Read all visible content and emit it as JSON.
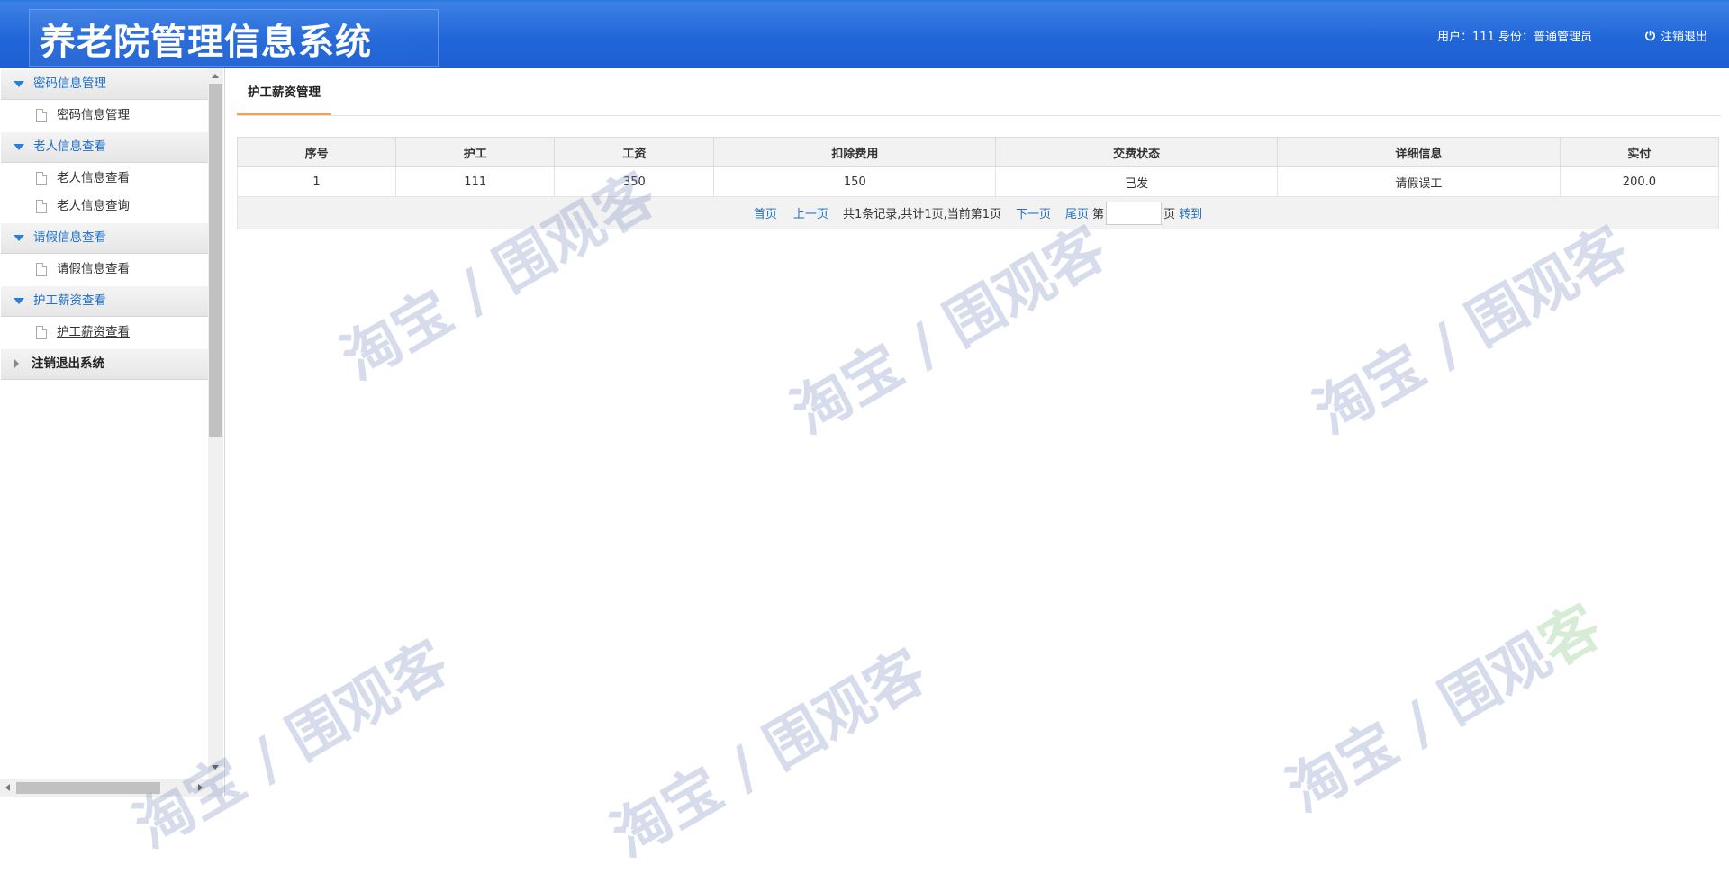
{
  "header": {
    "title": "养老院管理信息系统",
    "user_info": "用户：111 身份：普通管理员",
    "logout_label": "注销退出"
  },
  "sidebar": {
    "groups": [
      {
        "label": "密码信息管理",
        "items": [
          {
            "label": "密码信息管理"
          }
        ]
      },
      {
        "label": "老人信息查看",
        "items": [
          {
            "label": "老人信息查看"
          },
          {
            "label": "老人信息查询"
          }
        ]
      },
      {
        "label": "请假信息查看",
        "items": [
          {
            "label": "请假信息查看"
          }
        ]
      },
      {
        "label": "护工薪资查看",
        "items": [
          {
            "label": "护工薪资查看"
          }
        ]
      }
    ],
    "logout_group": "注销退出系统"
  },
  "main": {
    "tab": "护工薪资管理",
    "table": {
      "headers": [
        "序号",
        "护工",
        "工资",
        "扣除费用",
        "交费状态",
        "详细信息",
        "实付"
      ],
      "rows": [
        [
          "1",
          "111",
          "350",
          "150",
          "已发",
          "请假误工",
          "200.0"
        ]
      ]
    },
    "pager": {
      "first": "首页",
      "prev": "上一页",
      "summary": "共1条记录,共计1页,当前第1页",
      "next": "下一页",
      "last": "尾页",
      "page_prefix": "第",
      "page_suffix": "页",
      "go": "转到",
      "page_input": ""
    }
  },
  "watermark": {
    "text_main": "淘宝 / 围观",
    "text_tail": "客"
  }
}
